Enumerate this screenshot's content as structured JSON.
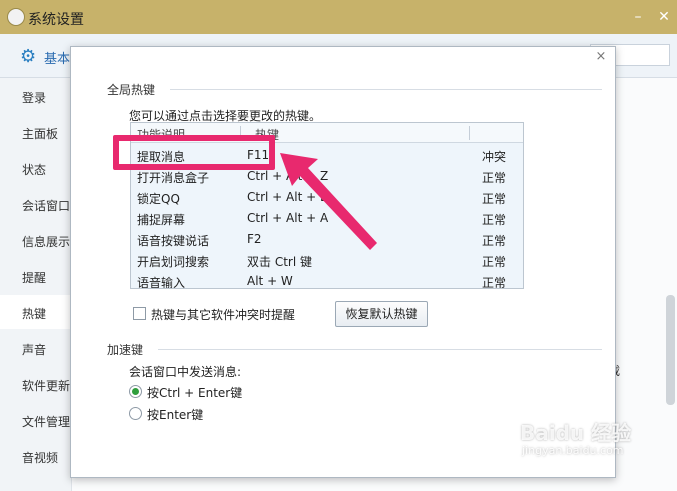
{
  "window": {
    "title": "系统设置",
    "minimize_glyph": "–",
    "close_glyph": "✕"
  },
  "toolbar": {
    "tab_basic": "基本"
  },
  "sidebar": {
    "items": [
      {
        "label": "登录"
      },
      {
        "label": "主面板"
      },
      {
        "label": "状态"
      },
      {
        "label": "会话窗口"
      },
      {
        "label": "信息展示"
      },
      {
        "label": "提醒"
      },
      {
        "label": "热键"
      },
      {
        "label": "声音"
      },
      {
        "label": "软件更新"
      },
      {
        "label": "文件管理"
      },
      {
        "label": "音视频"
      }
    ]
  },
  "background": {
    "partial_text": "载"
  },
  "dialog": {
    "close_glyph": "×",
    "global_hotkeys": {
      "title": "全局热键",
      "hint": "您可以通过点击选择要更改的热键。",
      "columns": [
        "功能说明",
        "热键",
        ""
      ],
      "rows": [
        {
          "function": "提取消息",
          "hotkey": "F11",
          "status": "冲突"
        },
        {
          "function": "打开消息盒子",
          "hotkey": "Ctrl + Alt + Z",
          "status": "正常"
        },
        {
          "function": "锁定QQ",
          "hotkey": "Ctrl + Alt + L",
          "status": "正常"
        },
        {
          "function": "捕捉屏幕",
          "hotkey": "Ctrl + Alt + A",
          "status": "正常"
        },
        {
          "function": "语音按键说话",
          "hotkey": "F2",
          "status": "正常"
        },
        {
          "function": "开启划词搜索",
          "hotkey": "双击 Ctrl 键",
          "status": "正常"
        },
        {
          "function": "语音输入",
          "hotkey": "Alt + W",
          "status": "正常"
        }
      ],
      "conflict_checkbox_label": "热键与其它软件冲突时提醒",
      "restore_button": "恢复默认热键"
    },
    "accelerator": {
      "title": "加速键",
      "send_label": "会话窗口中发送消息:",
      "options": [
        {
          "label": "按Ctrl + Enter键",
          "selected": true
        },
        {
          "label": "按Enter键",
          "selected": false
        }
      ]
    }
  },
  "watermark": {
    "main": "Baidu 经验",
    "sub": "jingyan.baidu.com"
  },
  "colors": {
    "highlight": "#e8296e",
    "radio_selected": "#2f9e3c",
    "titlebar": "#c7b26a"
  }
}
